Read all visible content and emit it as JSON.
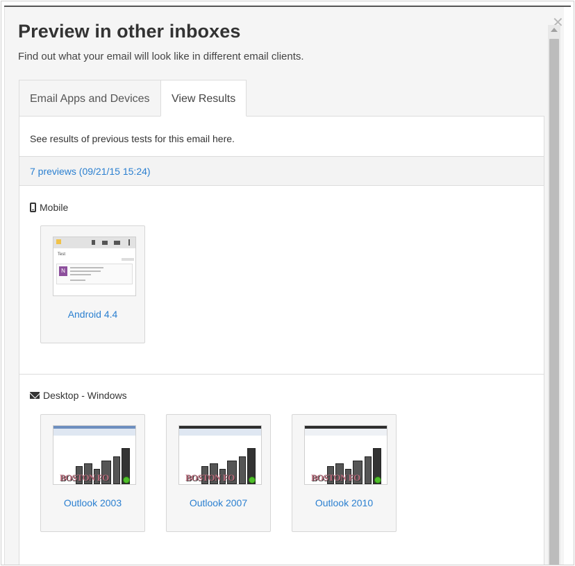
{
  "modal": {
    "title": "Preview in other inboxes",
    "subtitle": "Find out what your email will look like in different email clients.",
    "close_icon": "close-icon"
  },
  "tabs": [
    {
      "label": "Email Apps and Devices",
      "active": false
    },
    {
      "label": "View Results",
      "active": true
    }
  ],
  "results": {
    "info": "See results of previous tests for this email here.",
    "link": "7 previews (09/21/15 15:24)"
  },
  "sections": {
    "mobile": {
      "label": "Mobile",
      "icon": "phone-icon",
      "items": [
        {
          "label": "Android 4.4",
          "thumb_subject": "Test",
          "thumb_avatar": "N"
        }
      ]
    },
    "desktop": {
      "label": "Desktop - Windows",
      "icon": "mail-icon",
      "items": [
        {
          "label": "Outlook 2003",
          "thumb_text": "BOSTON FO"
        },
        {
          "label": "Outlook 2007",
          "thumb_text": "BOSTON FO"
        },
        {
          "label": "Outlook 2010",
          "thumb_text": "BOSTON FO"
        }
      ]
    }
  },
  "colors": {
    "link": "#2a7fd0",
    "panel_bg": "#f5f5f5",
    "avatar": "#8d4f9c"
  }
}
